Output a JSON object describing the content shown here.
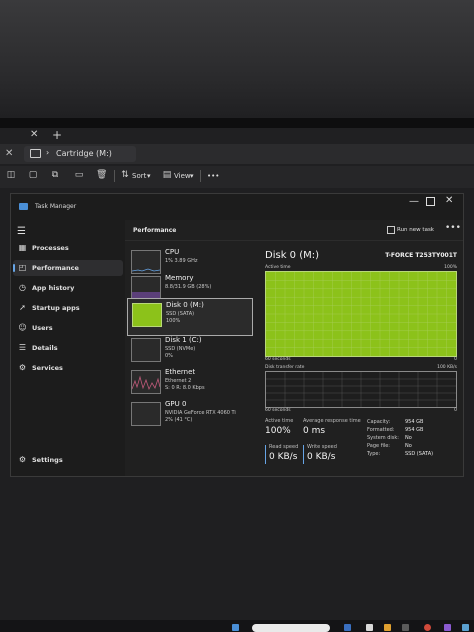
{
  "explorer": {
    "tab_close": "✕",
    "tab_add": "+",
    "nav_close": "✕",
    "breadcrumb_separator": "›",
    "location": "Cartridge (M:)",
    "toolbar": {
      "sort_label": "Sort",
      "view_label": "View",
      "more_label": "•••"
    }
  },
  "task_manager": {
    "title": "Task Manager",
    "window_controls": {
      "minimize": "—",
      "close": "✕"
    },
    "hamburger": "☰",
    "nav": [
      {
        "label": "Processes",
        "icon": "processes-icon"
      },
      {
        "label": "Performance",
        "icon": "performance-icon",
        "active": true
      },
      {
        "label": "App history",
        "icon": "app-history-icon"
      },
      {
        "label": "Startup apps",
        "icon": "startup-apps-icon"
      },
      {
        "label": "Users",
        "icon": "users-icon"
      },
      {
        "label": "Details",
        "icon": "details-icon"
      },
      {
        "label": "Services",
        "icon": "services-icon"
      }
    ],
    "settings_label": "Settings",
    "header": {
      "title": "Performance",
      "run_new_task": "Run new task",
      "more": "•••"
    },
    "devices": [
      {
        "name": "CPU",
        "sub1": "1% 3.89 GHz",
        "sub2": "",
        "thumb_color": "#2a3a55"
      },
      {
        "name": "Memory",
        "sub1": "8.8/31.9 GB (28%)",
        "sub2": "",
        "thumb_color": "#4a3a6a"
      },
      {
        "name": "Disk 0 (M:)",
        "sub1": "SSD (SATA)",
        "sub2": "100%",
        "thumb_color": "#8cc21a",
        "selected": true
      },
      {
        "name": "Disk 1 (C:)",
        "sub1": "SSD (NVMe)",
        "sub2": "0%",
        "thumb_color": "#2a2a2a"
      },
      {
        "name": "Ethernet",
        "sub1": "Ethernet 2",
        "sub2": "S: 0 R: 8.0 Kbps",
        "thumb_color": "#b04a6a"
      },
      {
        "name": "GPU 0",
        "sub1": "NVIDIA GeForce RTX 4060 Ti",
        "sub2": "2% (41 °C)",
        "thumb_color": "#2a2a2a"
      }
    ],
    "detail": {
      "title": "Disk 0 (M:)",
      "model": "T-FORCE T253TY001T",
      "active_time_label": "Active time",
      "active_time_max": "100%",
      "graph1_time": "60 seconds",
      "graph1_min": "0",
      "transfer_label": "Disk transfer rate",
      "transfer_max": "100 KB/s",
      "graph2_time": "60 seconds",
      "graph2_min": "0",
      "active_time_stat_label": "Active time",
      "active_time_value": "100%",
      "response_label": "Average response time",
      "response_value": "0 ms",
      "read_label": "Read speed",
      "read_value": "0 KB/s",
      "write_label": "Write speed",
      "write_value": "0 KB/s",
      "properties": [
        {
          "key": "Capacity:",
          "value": "954 GB"
        },
        {
          "key": "Formatted:",
          "value": "954 GB"
        },
        {
          "key": "System disk:",
          "value": "No"
        },
        {
          "key": "Page file:",
          "value": "No"
        },
        {
          "key": "Type:",
          "value": "SSD (SATA)"
        }
      ]
    },
    "colors": {
      "accent": "#67a5e6",
      "disk_fill": "#8cc21a",
      "background": "#1c1c1c"
    }
  }
}
